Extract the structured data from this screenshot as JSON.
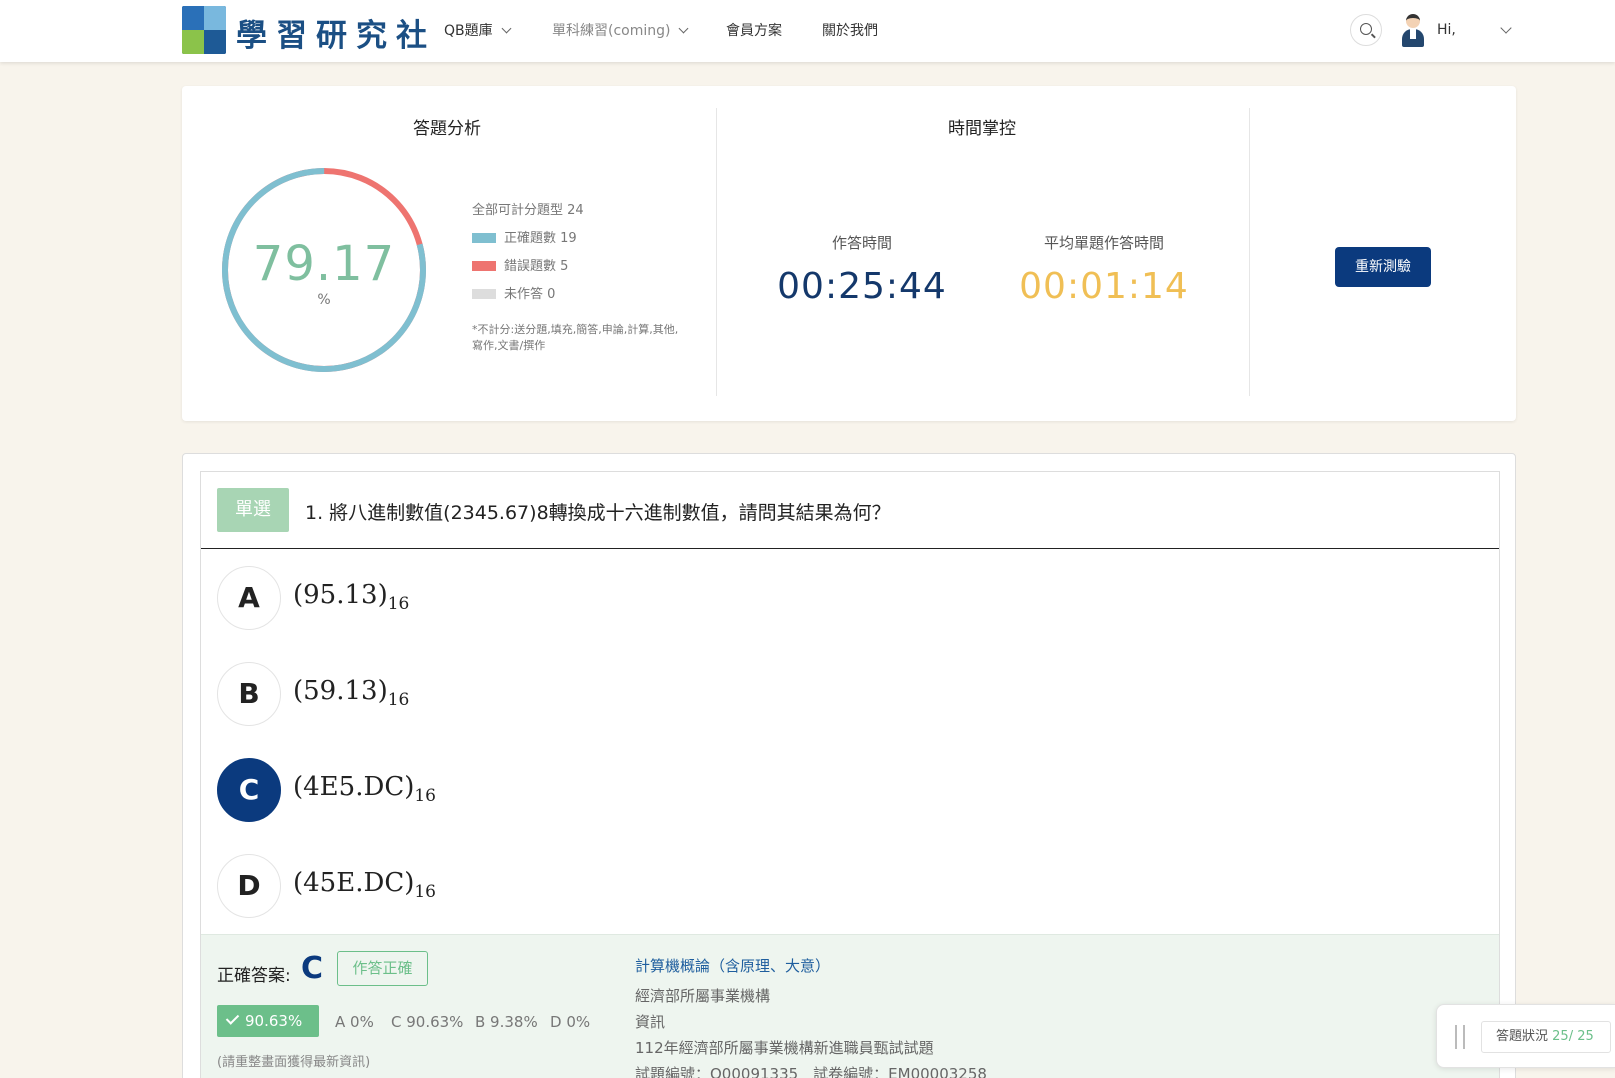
{
  "header": {
    "brand": "學習研究社",
    "nav": [
      {
        "label": "QB題庫",
        "dropdown": true
      },
      {
        "label": "單科練習(coming)",
        "dropdown": true
      },
      {
        "label": "會員方案",
        "dropdown": false
      },
      {
        "label": "關於我們",
        "dropdown": false
      }
    ],
    "user_greeting": "Hi,"
  },
  "analysis": {
    "title": "答題分析",
    "percent": "79.17",
    "percent_unit": "%",
    "correct_fraction": 0.7917,
    "total_label": "全部可計分題型 24",
    "legend": [
      {
        "label": "正確題數 19",
        "color": "#7fbfd0"
      },
      {
        "label": "錯誤題數 5",
        "color": "#ee7470"
      },
      {
        "label": "未作答 0",
        "color": "#dddddd"
      }
    ],
    "note": "*不計分:送分題,填充,簡答,申論,計算,其他,寫作,文書/撰作"
  },
  "time": {
    "title": "時間掌控",
    "elapsed_label": "作答時間",
    "elapsed": "00:25:44",
    "avg_label": "平均單題作答時間",
    "avg": "00:01:14",
    "elapsed_color": "#14386b",
    "avg_color": "#f0bf55"
  },
  "retest_label": "重新測驗",
  "question": {
    "type": "單選",
    "text": "1. 將八進制數值(2345.67)8轉換成十六進制數值，請問其結果為何？",
    "options": [
      {
        "letter": "A",
        "value": "(95.13)",
        "base": "16",
        "selected": false
      },
      {
        "letter": "B",
        "value": "(59.13)",
        "base": "16",
        "selected": false
      },
      {
        "letter": "C",
        "value": "(4E5.DC)",
        "base": "16",
        "selected": true
      },
      {
        "letter": "D",
        "value": "(45E.DC)",
        "base": "16",
        "selected": false
      }
    ]
  },
  "answer": {
    "label": "正確答案:",
    "correct": "C",
    "badge": "作答正確",
    "rate": "90.63%",
    "distribution": [
      "A 0%",
      "C 90.63%",
      "B 9.38%",
      "D 0%"
    ],
    "refresh_note": "(請重整畫面獲得最新資訊)",
    "subject": "計算機概論（含原理、大意）",
    "meta": [
      "經濟部所屬事業機構",
      "資訊",
      "112年經濟部所屬事業機構新進職員甄試試題",
      "試題編號：Q00091335　試卷編號：EM00003258"
    ]
  },
  "status": {
    "label": "答題狀況",
    "count": "25/ 25"
  }
}
